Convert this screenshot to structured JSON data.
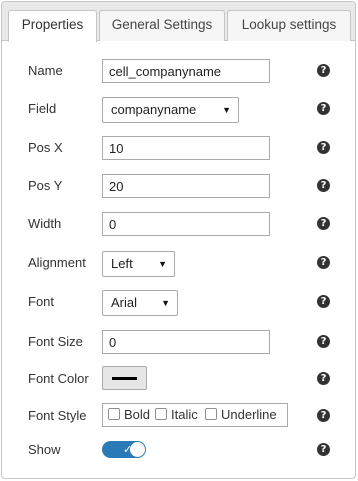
{
  "tabs": [
    {
      "label": "Properties",
      "active": true
    },
    {
      "label": "General Settings",
      "active": false
    },
    {
      "label": "Lookup settings",
      "active": false
    }
  ],
  "fields": {
    "name": {
      "label": "Name",
      "value": "cell_companyname"
    },
    "field": {
      "label": "Field",
      "value": "companyname"
    },
    "pos_x": {
      "label": "Pos X",
      "value": "10"
    },
    "pos_y": {
      "label": "Pos Y",
      "value": "20"
    },
    "width": {
      "label": "Width",
      "value": "0"
    },
    "alignment": {
      "label": "Alignment",
      "value": "Left"
    },
    "font": {
      "label": "Font",
      "value": "Arial"
    },
    "font_size": {
      "label": "Font Size",
      "value": "0"
    },
    "font_color": {
      "label": "Font Color",
      "value": "#000000"
    },
    "font_style": {
      "label": "Font Style",
      "options": [
        {
          "label": "Bold",
          "checked": false
        },
        {
          "label": "Italic",
          "checked": false
        },
        {
          "label": "Underline",
          "checked": false
        }
      ]
    },
    "show": {
      "label": "Show",
      "value": true
    }
  },
  "help_glyph": "?",
  "caret_glyph": "▼",
  "toggle_glyph": "✓",
  "icons": {
    "help": "question-circle-icon",
    "dropdown": "caret-down-icon",
    "check": "check-icon"
  },
  "colors": {
    "tab_bar": "#e9e9e9",
    "border": "#c5c5c5",
    "toggle_on": "#2a7ab8",
    "swatch": "#000000"
  }
}
